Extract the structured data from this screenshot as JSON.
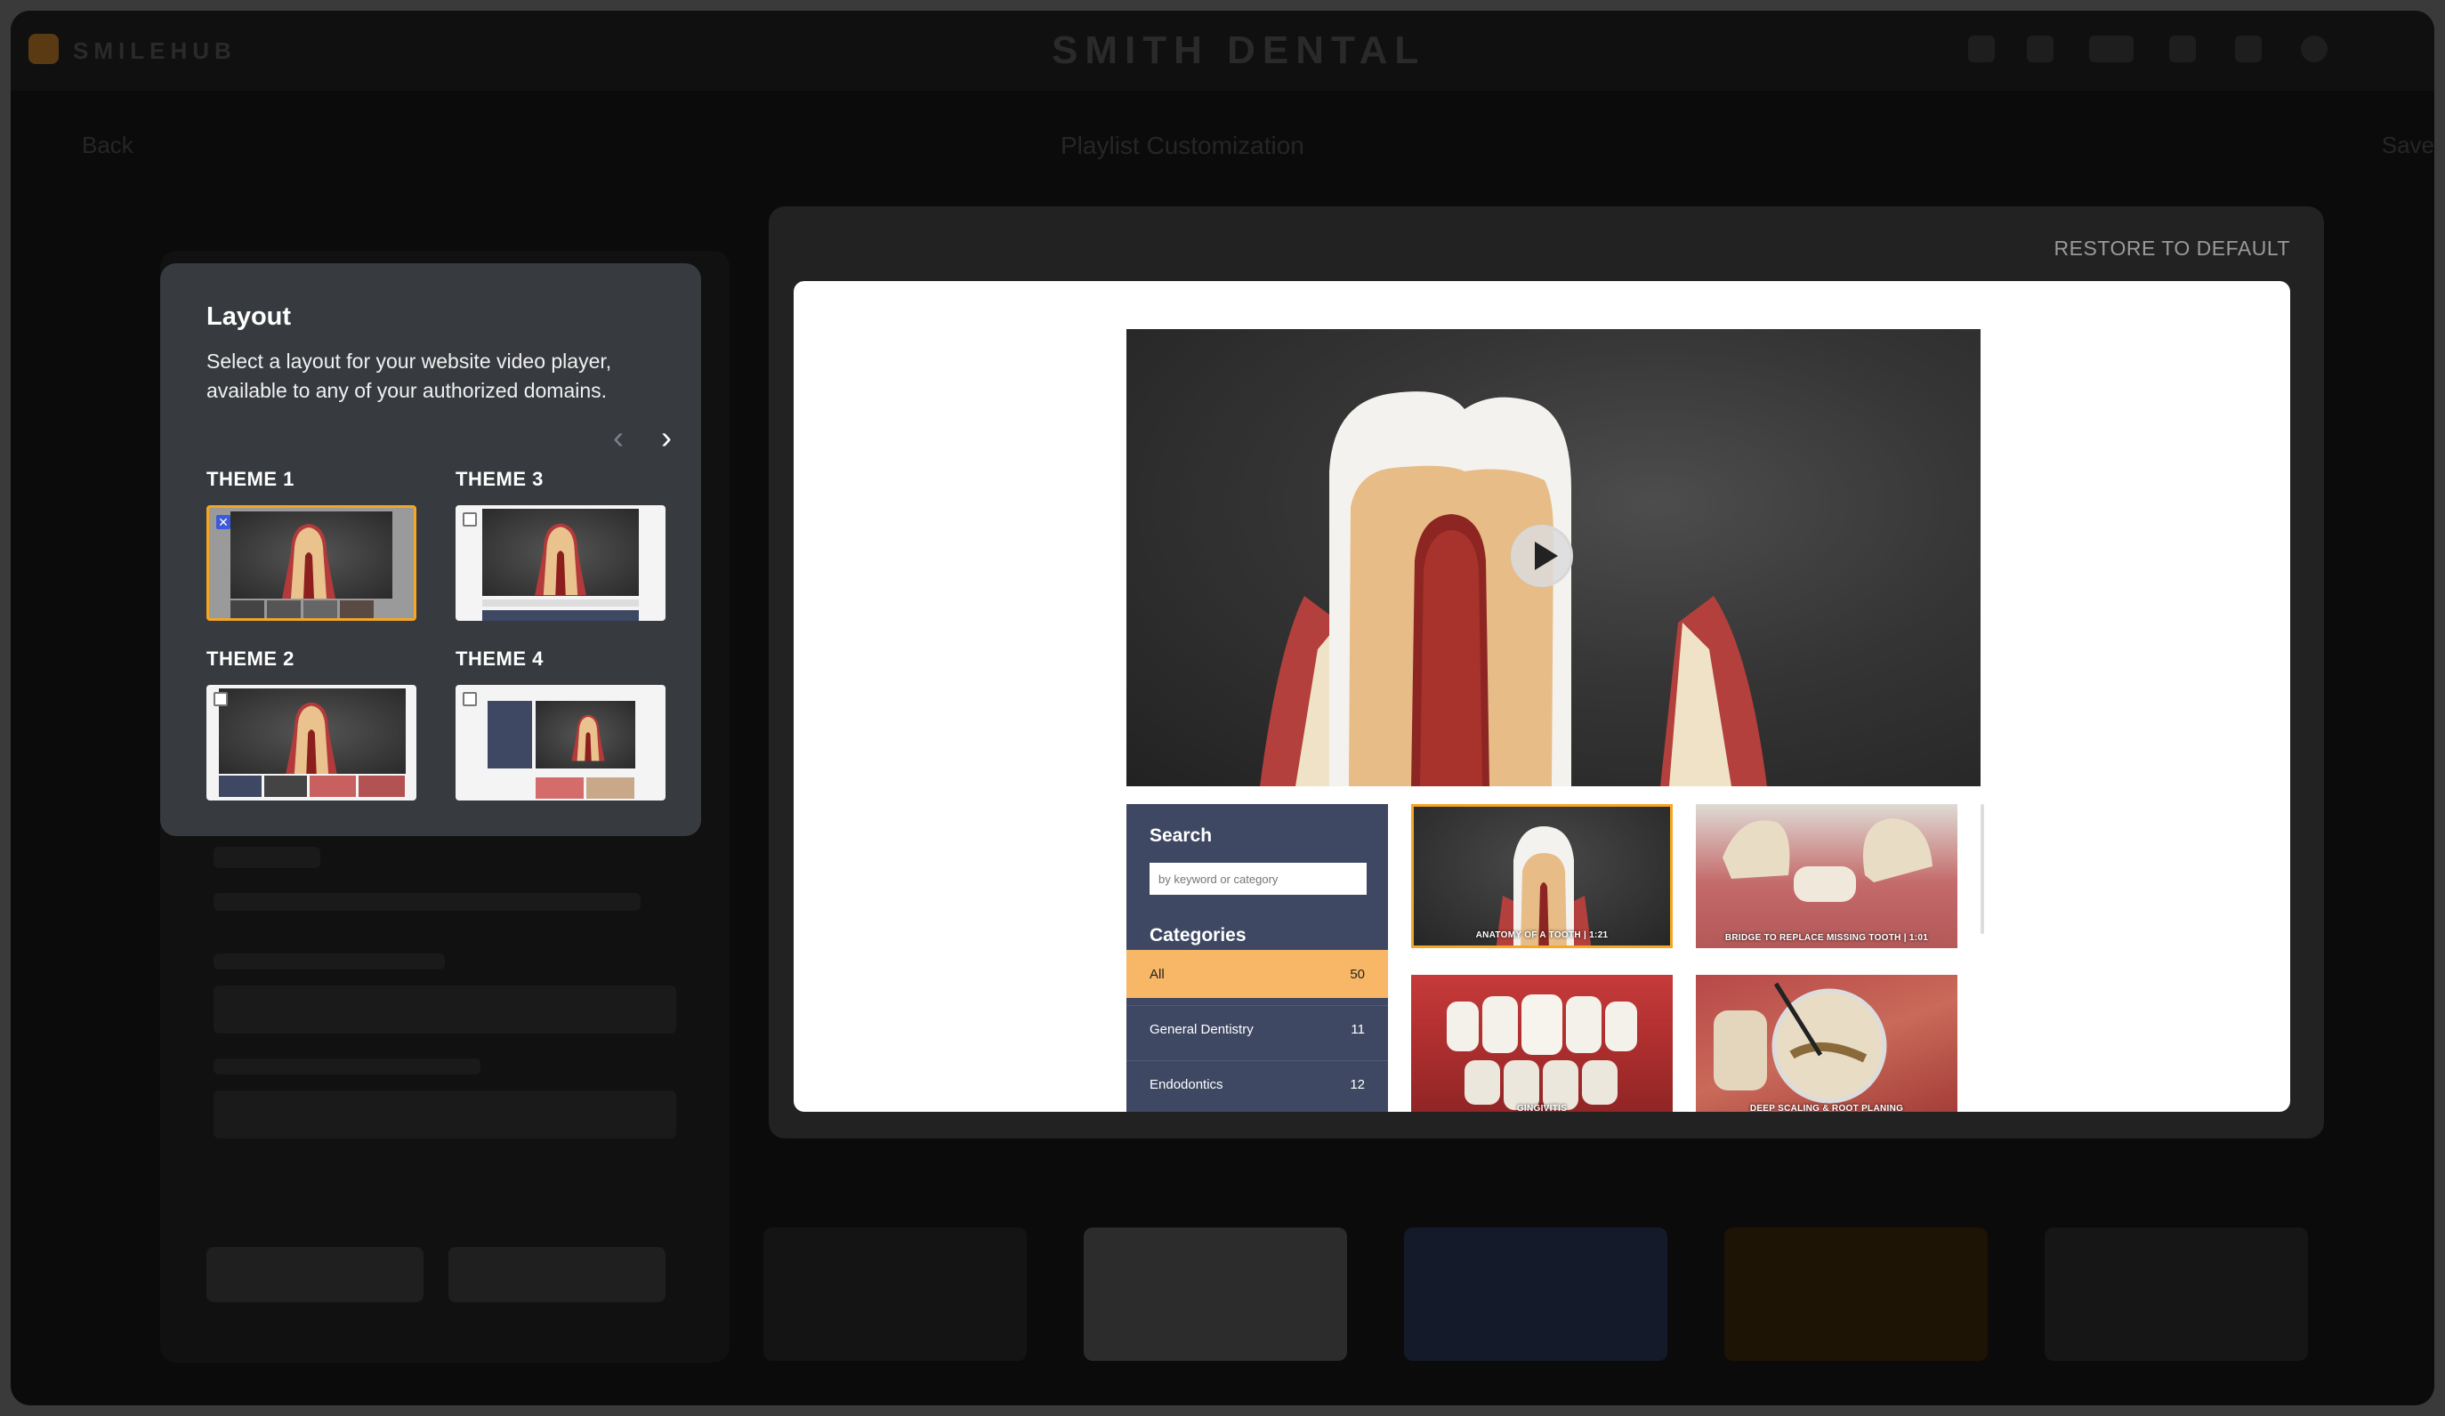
{
  "app": {
    "brand": "SMILEHUB",
    "site_title": "SMITH DENTAL",
    "back_label": "Back",
    "page_title": "Playlist Customization",
    "right_label": "Save"
  },
  "layout_panel": {
    "title": "Layout",
    "description": "Select a layout for your website video player, available to any of your authorized domains.",
    "prev_icon": "chevron-left-icon",
    "next_icon": "chevron-right-icon",
    "themes": [
      {
        "label": "THEME 1",
        "selected": true
      },
      {
        "label": "THEME 3",
        "selected": false
      },
      {
        "label": "THEME 2",
        "selected": false
      },
      {
        "label": "THEME 4",
        "selected": false
      }
    ]
  },
  "preview": {
    "restore_label": "RESTORE TO DEFAULT",
    "play_icon": "play-icon",
    "search": {
      "title": "Search",
      "placeholder": "by keyword or category"
    },
    "categories": {
      "title": "Categories",
      "items": [
        {
          "name": "All",
          "count": "50",
          "active": true
        },
        {
          "name": "General Dentistry",
          "count": "11",
          "active": false
        },
        {
          "name": "Endodontics",
          "count": "12",
          "active": false
        }
      ]
    },
    "videos": [
      {
        "label": "ANATOMY OF A TOOTH  |  1:21",
        "active": true
      },
      {
        "label": "BRIDGE TO REPLACE MISSING TOOTH  |  1:01",
        "active": false
      },
      {
        "label": "GINGIVITIS",
        "active": false
      },
      {
        "label": "DEEP SCALING & ROOT PLANING",
        "active": false
      }
    ]
  },
  "colors": {
    "accent": "#f5a623",
    "category_bg": "#3f4863",
    "category_active": "#f7b766",
    "checkbox_checked": "#3b5bdb"
  }
}
